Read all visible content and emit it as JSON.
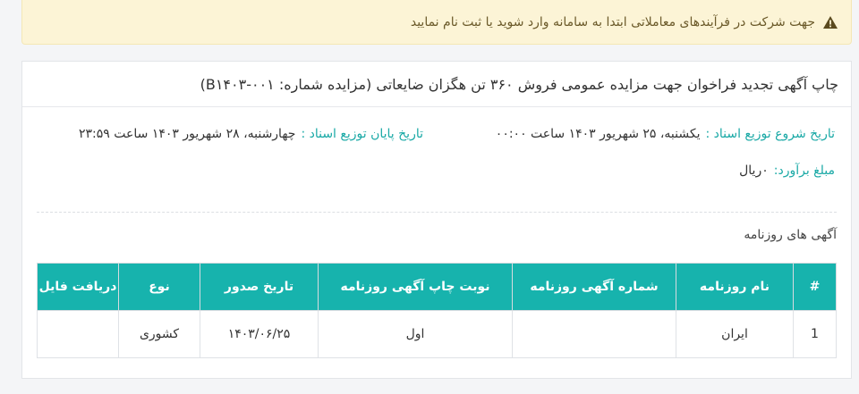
{
  "alert": {
    "message": "جهت شرکت در فرآیندهای معاملاتی ابتدا به سامانه وارد شوید یا ثبت نام نمایید",
    "icon": "warning-icon"
  },
  "card": {
    "title": "چاپ آگهی تجدید فراخوان جهت مزایده عمومی فروش ۳۶۰ تن هگزان ضایعاتی (مزایده شماره: ۰۰۱-B۱۴۰۳)",
    "start_label": "تاریخ شروع توزیع اسناد :",
    "start_value": "یکشنبه، ۲۵ شهریور ۱۴۰۳ ساعت ۰۰:۰۰",
    "end_label": "تاریخ پایان توزیع اسناد :",
    "end_value": "چهارشنبه، ۲۸ شهریور ۱۴۰۳ ساعت ۲۳:۵۹",
    "estimate_label": "مبلغ برآورد:",
    "estimate_value": "۰ریال",
    "section_title": "آگهی های روزنامه"
  },
  "table": {
    "headers": [
      "#",
      "نام روزنامه",
      "شماره آگهی روزنامه",
      "نوبت چاپ آگهی روزنامه",
      "تاریخ صدور",
      "نوع",
      "دریافت فایل"
    ],
    "rows": [
      [
        "1",
        "ایران",
        "",
        "اول",
        "۱۴۰۳/۰۶/۲۵",
        "کشوری",
        ""
      ]
    ]
  },
  "colors": {
    "accent": "#17b3ad",
    "alert_bg": "#fcf4d6",
    "warning": "#5a4a1e"
  }
}
